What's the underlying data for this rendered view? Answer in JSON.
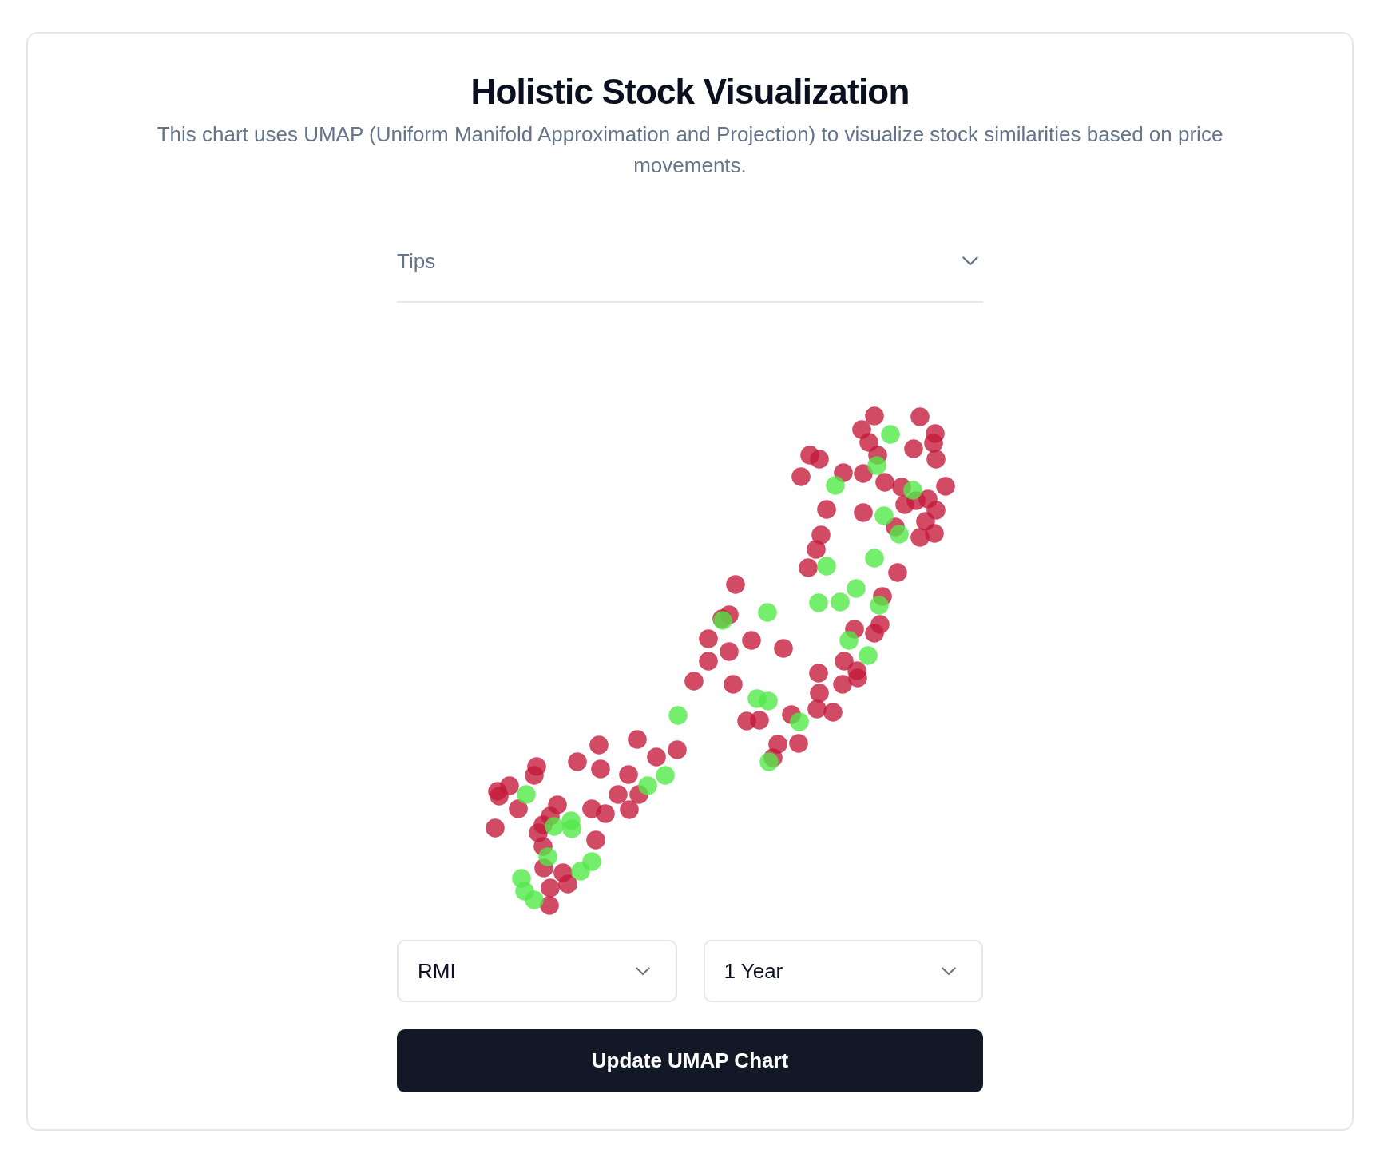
{
  "header": {
    "title": "Holistic Stock Visualization",
    "description": "This chart uses UMAP (Uniform Manifold Approximation and Projection) to visualize stock similarities based on price movements."
  },
  "tips": {
    "label": "Tips",
    "expanded": false
  },
  "selects": [
    {
      "value": "RMI"
    },
    {
      "value": "1 Year"
    }
  ],
  "update_button": {
    "label": "Update UMAP Chart"
  }
}
